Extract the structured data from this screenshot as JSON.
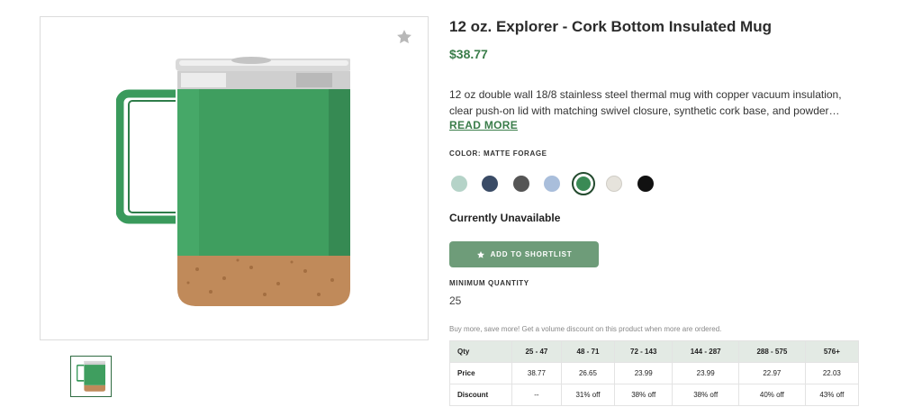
{
  "product": {
    "title": "12 oz. Explorer - Cork Bottom Insulated Mug",
    "price": "$38.77",
    "description": "12 oz double wall 18/8 stainless steel thermal mug with copper vacuum insulation, clear push-on lid with matching swivel closure, synthetic cork base, and powder…",
    "read_more_label": "READ MORE",
    "color_label": "COLOR: MATTE FORAGE",
    "availability": "Currently Unavailable",
    "shortlist_label": "ADD TO SHORTLIST",
    "min_qty_label": "MINIMUM QUANTITY",
    "min_qty_value": "25",
    "promo_text": "Buy more, save more! Get a volume discount on this product when more are ordered."
  },
  "swatches": [
    {
      "name": "swatch-seafoam",
      "color": "#b5d3c8",
      "selected": false
    },
    {
      "name": "swatch-navy",
      "color": "#3a4b66",
      "selected": false
    },
    {
      "name": "swatch-charcoal",
      "color": "#555555",
      "selected": false
    },
    {
      "name": "swatch-light-blue",
      "color": "#a9bedb",
      "selected": false
    },
    {
      "name": "swatch-matte-forage",
      "color": "#3a8a55",
      "selected": true
    },
    {
      "name": "swatch-cream",
      "color": "#e6e3dc",
      "selected": false
    },
    {
      "name": "swatch-black",
      "color": "#111111",
      "selected": false
    }
  ],
  "pricing": {
    "headers": [
      "Qty",
      "25 - 47",
      "48 - 71",
      "72 - 143",
      "144 - 287",
      "288 - 575",
      "576+"
    ],
    "rows": [
      {
        "label": "Price",
        "values": [
          "38.77",
          "26.65",
          "23.99",
          "23.99",
          "22.97",
          "22.03"
        ]
      },
      {
        "label": "Discount",
        "values": [
          "--",
          "31% off",
          "38% off",
          "38% off",
          "40% off",
          "43% off"
        ]
      }
    ]
  },
  "colors": {
    "accent": "#3a7d4a",
    "button": "#6e9c79",
    "table_header": "#e3eae4"
  },
  "icons": [
    "star-icon",
    "mug-image",
    "mug-thumbnail"
  ]
}
